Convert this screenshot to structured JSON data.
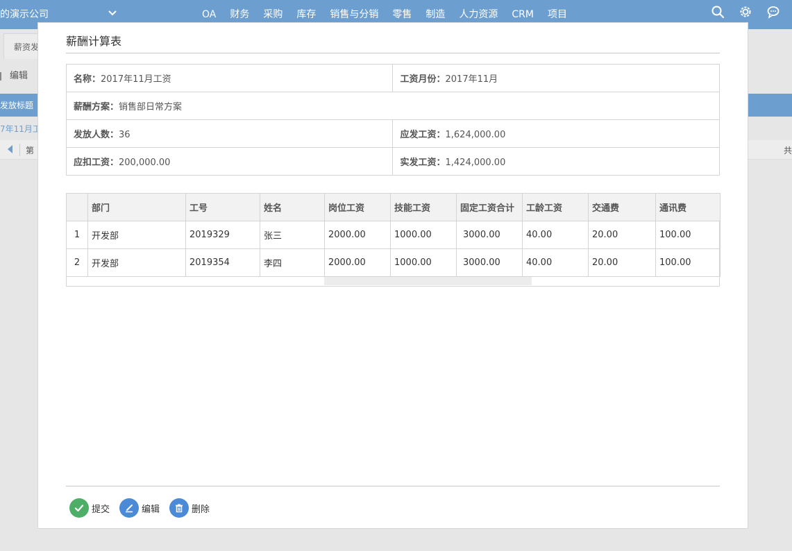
{
  "topbar": {
    "company": "的演示公司",
    "nav": [
      "OA",
      "财务",
      "采购",
      "库存",
      "销售与分销",
      "零售",
      "制造",
      "人力资源",
      "CRM",
      "项目"
    ],
    "icons": [
      "search-icon",
      "gear-icon",
      "chat-icon"
    ]
  },
  "background": {
    "tab_label": "薪资发",
    "edit_label": "编辑",
    "header_label": "发放标题",
    "row_text": "7年11月工",
    "pager_page": "第",
    "pager_total": "共"
  },
  "modal": {
    "title": "薪酬计算表",
    "info": {
      "name_label": "名称：",
      "name_value": "2017年11月工资",
      "month_label": "工资月份：",
      "month_value": "2017年11月",
      "plan_label": "薪酬方案：",
      "plan_value": "销售部日常方案",
      "count_label": "发放人数：",
      "count_value": "36",
      "payable_label": "应发工资：",
      "payable_value": "1,624,000.00",
      "deduct_label": "应扣工资：",
      "deduct_value": "200,000.00",
      "actual_label": "实发工资：",
      "actual_value": "1,424,000.00"
    },
    "grid": {
      "columns": [
        "",
        "部门",
        "工号",
        "姓名",
        "岗位工资",
        "技能工资",
        "固定工资合计",
        "工龄工资",
        "交通费",
        "通讯费"
      ],
      "rows": [
        [
          "1",
          "开发部",
          "2019329",
          "张三",
          "2000.00",
          "1000.00",
          "3000.00",
          "40.00",
          "20.00",
          "100.00"
        ],
        [
          "2",
          "开发部",
          "2019354",
          "李四",
          "2000.00",
          "1000.00",
          "3000.00",
          "40.00",
          "20.00",
          "100.00"
        ]
      ]
    },
    "footer": {
      "submit_label": "提交",
      "edit_label": "编辑",
      "delete_label": "删除"
    }
  },
  "colors": {
    "nav_bg": "#6c9fd0",
    "submit": "#4cae67",
    "edit": "#4a8ad6",
    "delete": "#4a8ad6"
  }
}
